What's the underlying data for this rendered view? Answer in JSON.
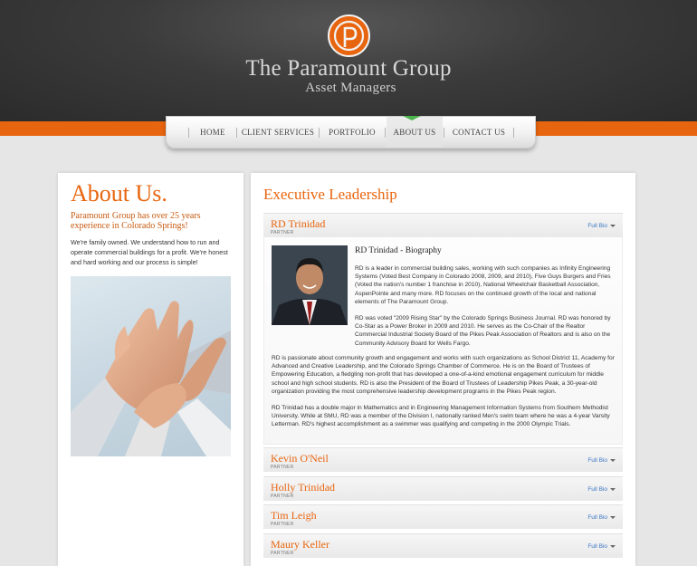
{
  "brand": {
    "title": "The Paramount Group",
    "subtitle": "Asset Managers",
    "accent_color": "#e8650f",
    "logo_icon": "p-monogram-icon"
  },
  "nav": {
    "items": [
      {
        "label": "HOME"
      },
      {
        "label": "CLIENT SERVICES"
      },
      {
        "label": "PORTFOLIO"
      },
      {
        "label": "ABOUT US",
        "active": true
      },
      {
        "label": "CONTACT US"
      }
    ]
  },
  "about": {
    "title": "About Us.",
    "tagline": "Paramount Group has over 25 years experience in Colorado Springs!",
    "body": "We're family owned. We understand how to run and operate commercial buildings for a profit. We're honest and hard working and our process is simple!",
    "image": "hands-together-photo"
  },
  "leadership": {
    "title": "Executive Leadership",
    "link_label": "Full Bio",
    "members": [
      {
        "name": "RD Trinidad",
        "role": "PARTNER"
      },
      {
        "name": "Kevin O'Neil",
        "role": "PARTNER"
      },
      {
        "name": "Holly Trinidad",
        "role": "PARTNER"
      },
      {
        "name": "Tim Leigh",
        "role": "PARTNER"
      },
      {
        "name": "Maury Keller",
        "role": "PARTNER"
      }
    ],
    "bio": {
      "heading": "RD Trinidad - Biography",
      "paragraphs": [
        "RD is a leader in commercial building sales, working with such companies as Infinity Engineering Systems (Voted Best Company in Colorado 2008, 2009, and 2010), Five Guys Burgers and Fries (Voted the nation's number 1 franchise in 2010), National Wheelchair Basketball Association, AspenPointe and many more. RD focuses on the continued growth of the local and national elements of The Paramount Group.",
        "RD was voted \"2009 Rising Star\" by the Colorado Springs Business Journal. RD was honored by Co-Star as a Power Broker in 2009 and 2010. He serves as the Co-Chair of the Realtor Commercial Industrial Society Board of the Pikes Peak Association of Realtors and is also on the Community Advisory Board for Wells Fargo.",
        "RD is passionate about community growth and engagement and works with such organizations as School District 11, Academy for Advanced and Creative Leadership, and the Colorado Springs Chamber of Commerce. He is on the Board of Trustees of Empowering Education, a fledgling non-profit that has developed a one-of-a-kind emotional engagement curriculum for middle school and high school students. RD is also the President of the Board of Trustees of Leadership Pikes Peak, a 30-year-old organization providing the most comprehensive leadership development programs in the Pikes Peak region.",
        "RD Trinidad has a double major in Mathematics and in Engineering Management Information Systems from Southern Methodist University. While at SMU, RD was a member of the Division I, nationally ranked Men's swim team where he was a 4-year Varsity Letterman. RD's highest accomplishment as a swimmer was qualifying and competing in the 2000 Olympic Trials."
      ]
    }
  }
}
